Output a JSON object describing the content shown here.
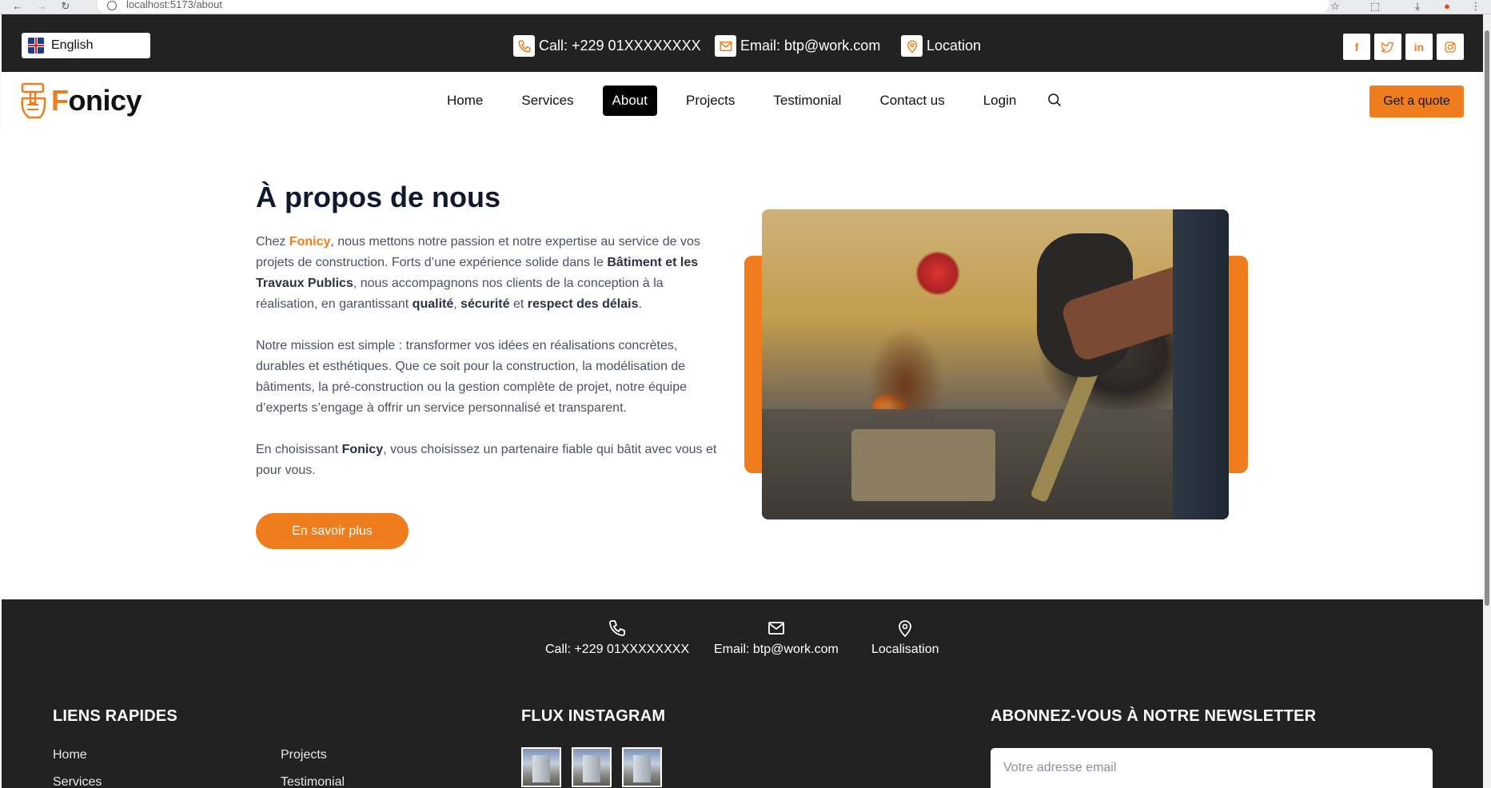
{
  "browser": {
    "url": "localhost:5173/about"
  },
  "topbar": {
    "language": "English",
    "call": "Call: +229 01XXXXXXXX",
    "email": "Email: btp@work.com",
    "location": "Location",
    "socials": [
      "facebook-icon",
      "twitter-icon",
      "linkedin-icon",
      "instagram-icon"
    ]
  },
  "nav": {
    "logo_text": "Fonicy",
    "items": [
      "Home",
      "Services",
      "About",
      "Projects",
      "Testimonial",
      "Contact us",
      "Login"
    ],
    "active": "About",
    "quote_button": "Get a quote"
  },
  "about": {
    "title": "À propos de nous",
    "p1": {
      "t1": "Chez ",
      "brand": "Fonicy",
      "t2": ", nous mettons notre passion et notre expertise au service de vos projets de construction. Forts d’une expérience solide dans le ",
      "b1": "Bâtiment et les Travaux Publics",
      "t3": ", nous accompagnons nos clients de la conception à la réalisation, en garantissant ",
      "b2": "qualité",
      "t4": ", ",
      "b3": "sécurité",
      "t5": " et ",
      "b4": "respect des délais",
      "t6": "."
    },
    "p2": "Notre mission est simple : transformer vos idées en réalisations concrètes, durables et esthétiques. Que ce soit pour la construction, la modélisation de bâtiments, la pré-construction ou la gestion complète de projet, notre équipe d’experts s’engage à offrir un service personnalisé et transparent.",
    "p3": {
      "t1": "En choisissant ",
      "brand": "Fonicy",
      "t2": ", vous choisissez un partenaire fiable qui bâtit avec vous et pour vous."
    },
    "button": "En savoir plus"
  },
  "footer": {
    "call": "Call: +229 01XXXXXXXX",
    "email": "Email: btp@work.com",
    "location": "Localisation",
    "quick_links_title": "LIENS RAPIDES",
    "quick_links": [
      "Home",
      "Services",
      "Projects",
      "Testimonial"
    ],
    "instagram_title": "FLUX INSTAGRAM",
    "newsletter_title": "ABONNEZ-VOUS À NOTRE NEWSLETTER",
    "newsletter_placeholder": "Votre adresse email"
  },
  "colors": {
    "accent": "#f07d1d",
    "dark": "#222222"
  }
}
